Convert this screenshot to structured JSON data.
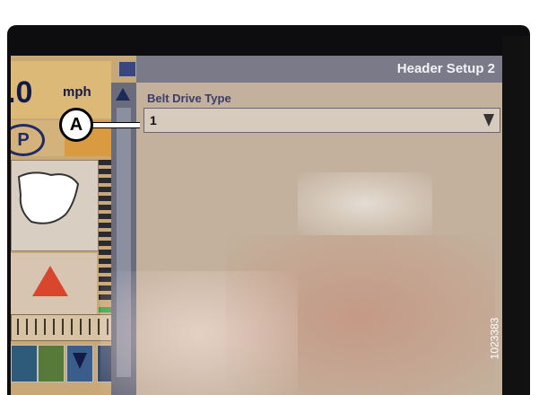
{
  "status": {
    "speed_value": ".0",
    "speed_unit": "mph",
    "park_label": "P"
  },
  "header": {
    "title": "Header Setup 2"
  },
  "field": {
    "label": "Belt Drive Type",
    "value": "1"
  },
  "callout": {
    "label": "A"
  },
  "figure_number": "1023383",
  "colors": {
    "title_bar": "#7b7a89",
    "warning": "#d9452d",
    "speed_text": "#131a47"
  }
}
